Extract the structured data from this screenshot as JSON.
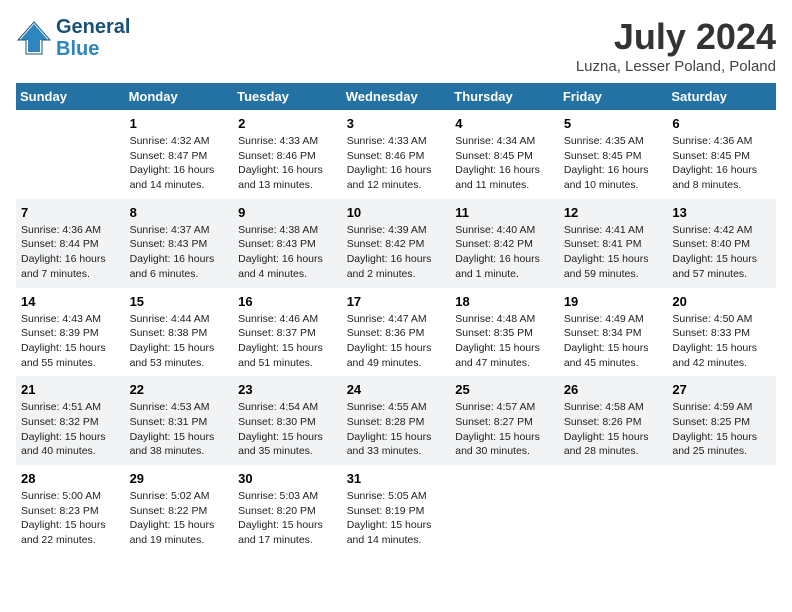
{
  "header": {
    "logo_line1": "General",
    "logo_line2": "Blue",
    "month_year": "July 2024",
    "location": "Luzna, Lesser Poland, Poland"
  },
  "weekdays": [
    "Sunday",
    "Monday",
    "Tuesday",
    "Wednesday",
    "Thursday",
    "Friday",
    "Saturday"
  ],
  "weeks": [
    [
      {
        "day": "",
        "info": ""
      },
      {
        "day": "1",
        "info": "Sunrise: 4:32 AM\nSunset: 8:47 PM\nDaylight: 16 hours\nand 14 minutes."
      },
      {
        "day": "2",
        "info": "Sunrise: 4:33 AM\nSunset: 8:46 PM\nDaylight: 16 hours\nand 13 minutes."
      },
      {
        "day": "3",
        "info": "Sunrise: 4:33 AM\nSunset: 8:46 PM\nDaylight: 16 hours\nand 12 minutes."
      },
      {
        "day": "4",
        "info": "Sunrise: 4:34 AM\nSunset: 8:45 PM\nDaylight: 16 hours\nand 11 minutes."
      },
      {
        "day": "5",
        "info": "Sunrise: 4:35 AM\nSunset: 8:45 PM\nDaylight: 16 hours\nand 10 minutes."
      },
      {
        "day": "6",
        "info": "Sunrise: 4:36 AM\nSunset: 8:45 PM\nDaylight: 16 hours\nand 8 minutes."
      }
    ],
    [
      {
        "day": "7",
        "info": "Sunrise: 4:36 AM\nSunset: 8:44 PM\nDaylight: 16 hours\nand 7 minutes."
      },
      {
        "day": "8",
        "info": "Sunrise: 4:37 AM\nSunset: 8:43 PM\nDaylight: 16 hours\nand 6 minutes."
      },
      {
        "day": "9",
        "info": "Sunrise: 4:38 AM\nSunset: 8:43 PM\nDaylight: 16 hours\nand 4 minutes."
      },
      {
        "day": "10",
        "info": "Sunrise: 4:39 AM\nSunset: 8:42 PM\nDaylight: 16 hours\nand 2 minutes."
      },
      {
        "day": "11",
        "info": "Sunrise: 4:40 AM\nSunset: 8:42 PM\nDaylight: 16 hours\nand 1 minute."
      },
      {
        "day": "12",
        "info": "Sunrise: 4:41 AM\nSunset: 8:41 PM\nDaylight: 15 hours\nand 59 minutes."
      },
      {
        "day": "13",
        "info": "Sunrise: 4:42 AM\nSunset: 8:40 PM\nDaylight: 15 hours\nand 57 minutes."
      }
    ],
    [
      {
        "day": "14",
        "info": "Sunrise: 4:43 AM\nSunset: 8:39 PM\nDaylight: 15 hours\nand 55 minutes."
      },
      {
        "day": "15",
        "info": "Sunrise: 4:44 AM\nSunset: 8:38 PM\nDaylight: 15 hours\nand 53 minutes."
      },
      {
        "day": "16",
        "info": "Sunrise: 4:46 AM\nSunset: 8:37 PM\nDaylight: 15 hours\nand 51 minutes."
      },
      {
        "day": "17",
        "info": "Sunrise: 4:47 AM\nSunset: 8:36 PM\nDaylight: 15 hours\nand 49 minutes."
      },
      {
        "day": "18",
        "info": "Sunrise: 4:48 AM\nSunset: 8:35 PM\nDaylight: 15 hours\nand 47 minutes."
      },
      {
        "day": "19",
        "info": "Sunrise: 4:49 AM\nSunset: 8:34 PM\nDaylight: 15 hours\nand 45 minutes."
      },
      {
        "day": "20",
        "info": "Sunrise: 4:50 AM\nSunset: 8:33 PM\nDaylight: 15 hours\nand 42 minutes."
      }
    ],
    [
      {
        "day": "21",
        "info": "Sunrise: 4:51 AM\nSunset: 8:32 PM\nDaylight: 15 hours\nand 40 minutes."
      },
      {
        "day": "22",
        "info": "Sunrise: 4:53 AM\nSunset: 8:31 PM\nDaylight: 15 hours\nand 38 minutes."
      },
      {
        "day": "23",
        "info": "Sunrise: 4:54 AM\nSunset: 8:30 PM\nDaylight: 15 hours\nand 35 minutes."
      },
      {
        "day": "24",
        "info": "Sunrise: 4:55 AM\nSunset: 8:28 PM\nDaylight: 15 hours\nand 33 minutes."
      },
      {
        "day": "25",
        "info": "Sunrise: 4:57 AM\nSunset: 8:27 PM\nDaylight: 15 hours\nand 30 minutes."
      },
      {
        "day": "26",
        "info": "Sunrise: 4:58 AM\nSunset: 8:26 PM\nDaylight: 15 hours\nand 28 minutes."
      },
      {
        "day": "27",
        "info": "Sunrise: 4:59 AM\nSunset: 8:25 PM\nDaylight: 15 hours\nand 25 minutes."
      }
    ],
    [
      {
        "day": "28",
        "info": "Sunrise: 5:00 AM\nSunset: 8:23 PM\nDaylight: 15 hours\nand 22 minutes."
      },
      {
        "day": "29",
        "info": "Sunrise: 5:02 AM\nSunset: 8:22 PM\nDaylight: 15 hours\nand 19 minutes."
      },
      {
        "day": "30",
        "info": "Sunrise: 5:03 AM\nSunset: 8:20 PM\nDaylight: 15 hours\nand 17 minutes."
      },
      {
        "day": "31",
        "info": "Sunrise: 5:05 AM\nSunset: 8:19 PM\nDaylight: 15 hours\nand 14 minutes."
      },
      {
        "day": "",
        "info": ""
      },
      {
        "day": "",
        "info": ""
      },
      {
        "day": "",
        "info": ""
      }
    ]
  ]
}
